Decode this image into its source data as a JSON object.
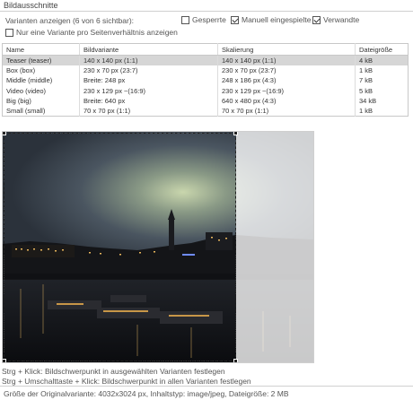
{
  "section": {
    "title": "Bildausschnitte"
  },
  "filters": {
    "label": "Varianten anzeigen (6 von 6 sichtbar):",
    "options": [
      {
        "label": "Gesperrte",
        "checked": false
      },
      {
        "label": "Manuell eingespielte",
        "checked": true
      },
      {
        "label": "Verwandte",
        "checked": true
      }
    ],
    "aspect_option": {
      "label": "Nur eine Variante pro Seitenverhältnis anzeigen",
      "checked": false
    }
  },
  "table": {
    "headers": [
      "Name",
      "Bildvariante",
      "Skalierung",
      "Dateigröße"
    ],
    "rows": [
      [
        "Teaser (teaser)",
        "140 x 140 px (1:1)",
        "140 x 140 px (1:1)",
        "4 kB"
      ],
      [
        "Box (box)",
        "230 x 70 px (23:7)",
        "230 x 70 px (23:7)",
        "1 kB"
      ],
      [
        "Middle (middle)",
        "Breite: 248 px",
        "248 x 186 px (4:3)",
        "7 kB"
      ],
      [
        "Video (video)",
        "230 x 129 px ~(16:9)",
        "230 x 129 px ~(16:9)",
        "5 kB"
      ],
      [
        "Big (big)",
        "Breite: 640 px",
        "640 x 480 px (4:3)",
        "34 kB"
      ],
      [
        "Small (small)",
        "70 x 70 px (1:1)",
        "70 x 70 px (1:1)",
        "1 kB"
      ]
    ],
    "selected_row": 0
  },
  "help": {
    "line1": "Strg + Klick: Bildschwerpunkt in ausgewählten Varianten festlegen",
    "line2": "Strg + Umschalttaste + Klick: Bildschwerpunkt in allen Varianten festlegen"
  },
  "footer": {
    "text": "Größe der Originalvariante: 4032x3024 px, Inhaltstyp: image/jpeg, Dateigröße: 2 MB"
  }
}
